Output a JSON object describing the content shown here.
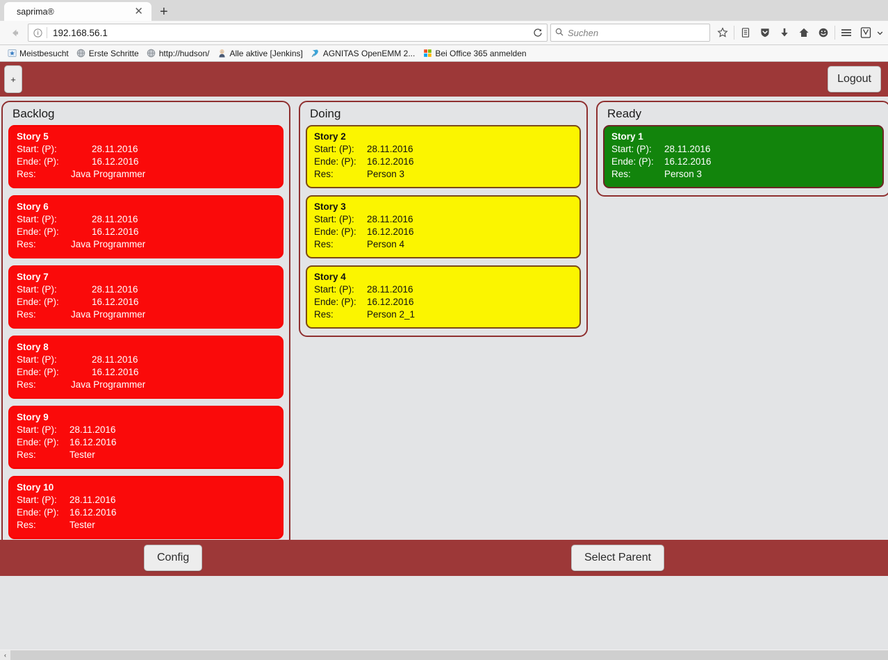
{
  "browser": {
    "tab": {
      "title": "saprima®",
      "close_label": "✕",
      "newtab_label": "+"
    },
    "nav": {
      "back_label": "⬅",
      "info_label": "ⓘ",
      "url": "192.168.56.1",
      "reload_label": "⟳"
    },
    "search": {
      "placeholder": "Suchen",
      "icon": "search-icon"
    },
    "toolbar_icons": [
      "bookmark-star-icon",
      "reading-list-icon",
      "pocket-shield-icon",
      "downloads-arrow-icon",
      "home-icon",
      "sync-smiley-icon",
      "hamburger-menu-icon",
      "firefox-account-icon",
      "chevron-down-icon"
    ],
    "bookmarks": [
      {
        "label": "Meistbesucht",
        "icon": "star-folder-icon"
      },
      {
        "label": "Erste Schritte",
        "icon": "globe-icon"
      },
      {
        "label": "http://hudson/",
        "icon": "globe-icon"
      },
      {
        "label": "Alle aktive [Jenkins]",
        "icon": "jenkins-butler-icon"
      },
      {
        "label": "AGNITAS OpenEMM 2...",
        "icon": "openemm-icon"
      },
      {
        "label": "Bei Office 365 anmelden",
        "icon": "microsoft-icon"
      }
    ]
  },
  "app": {
    "header": {
      "add_label": "+",
      "logout_label": "Logout"
    },
    "footer": {
      "config_label": "Config",
      "select_parent_label": "Select Parent"
    },
    "colors": {
      "header_bar": "#9d3838",
      "column_border": "#8f3030",
      "page_background": "#e3e4e6",
      "card_red": "#fa0a0a",
      "card_yellow": "#fbf500",
      "card_green": "#12840c"
    },
    "labels": {
      "start": "Start: (P):",
      "ende": "Ende: (P):",
      "res": "Res:"
    },
    "columns": [
      {
        "title": "Backlog",
        "cards": [
          {
            "title": "Story 5",
            "start": "28.11.2016",
            "ende": "16.12.2016",
            "res": "Java Programmer",
            "color": "red",
            "width": "wide"
          },
          {
            "title": "Story 6",
            "start": "28.11.2016",
            "ende": "16.12.2016",
            "res": "Java Programmer",
            "color": "red",
            "width": "wide"
          },
          {
            "title": "Story 7",
            "start": "28.11.2016",
            "ende": "16.12.2016",
            "res": "Java Programmer",
            "color": "red",
            "width": "wide"
          },
          {
            "title": "Story 8",
            "start": "28.11.2016",
            "ende": "16.12.2016",
            "res": "Java Programmer",
            "color": "red",
            "width": "wide"
          },
          {
            "title": "Story 9",
            "start": "28.11.2016",
            "ende": "16.12.2016",
            "res": "Tester",
            "color": "red",
            "width": "narrow"
          },
          {
            "title": "Story 10",
            "start": "28.11.2016",
            "ende": "16.12.2016",
            "res": "Tester",
            "color": "red",
            "width": "narrow"
          }
        ]
      },
      {
        "title": "Doing",
        "cards": [
          {
            "title": "Story 2",
            "start": "28.11.2016",
            "ende": "16.12.2016",
            "res": "Person 3",
            "color": "yellow",
            "width": "narrow"
          },
          {
            "title": "Story 3",
            "start": "28.11.2016",
            "ende": "16.12.2016",
            "res": "Person 4",
            "color": "yellow",
            "width": "narrow"
          },
          {
            "title": "Story 4",
            "start": "28.11.2016",
            "ende": "16.12.2016",
            "res": "Person 2_1",
            "color": "yellow",
            "width": "narrow"
          }
        ]
      },
      {
        "title": "Ready",
        "cards": [
          {
            "title": "Story 1",
            "start": "28.11.2016",
            "ende": "16.12.2016",
            "res": "Person 3",
            "color": "green",
            "width": "narrow"
          }
        ]
      }
    ]
  },
  "scrollbar": {
    "left_arrow": "‹",
    "right_arrow": "›"
  }
}
